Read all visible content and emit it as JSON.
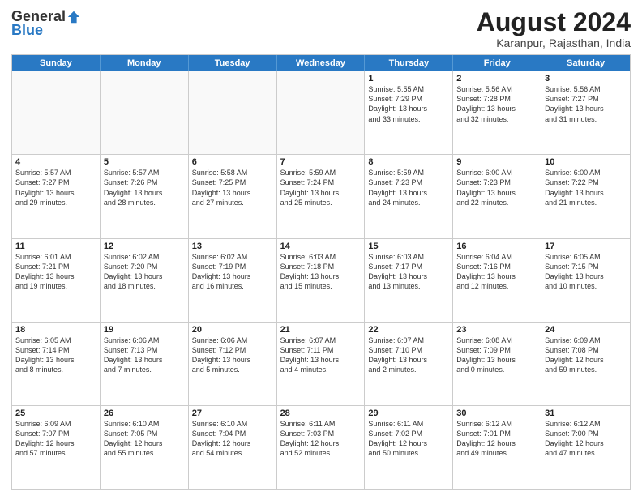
{
  "logo": {
    "general": "General",
    "blue": "Blue"
  },
  "title": "August 2024",
  "location": "Karanpur, Rajasthan, India",
  "days": [
    "Sunday",
    "Monday",
    "Tuesday",
    "Wednesday",
    "Thursday",
    "Friday",
    "Saturday"
  ],
  "weeks": [
    [
      {
        "day": "",
        "info": "",
        "empty": true
      },
      {
        "day": "",
        "info": "",
        "empty": true
      },
      {
        "day": "",
        "info": "",
        "empty": true
      },
      {
        "day": "",
        "info": "",
        "empty": true
      },
      {
        "day": "1",
        "info": "Sunrise: 5:55 AM\nSunset: 7:29 PM\nDaylight: 13 hours\nand 33 minutes.",
        "empty": false
      },
      {
        "day": "2",
        "info": "Sunrise: 5:56 AM\nSunset: 7:28 PM\nDaylight: 13 hours\nand 32 minutes.",
        "empty": false
      },
      {
        "day": "3",
        "info": "Sunrise: 5:56 AM\nSunset: 7:27 PM\nDaylight: 13 hours\nand 31 minutes.",
        "empty": false
      }
    ],
    [
      {
        "day": "4",
        "info": "Sunrise: 5:57 AM\nSunset: 7:27 PM\nDaylight: 13 hours\nand 29 minutes.",
        "empty": false
      },
      {
        "day": "5",
        "info": "Sunrise: 5:57 AM\nSunset: 7:26 PM\nDaylight: 13 hours\nand 28 minutes.",
        "empty": false
      },
      {
        "day": "6",
        "info": "Sunrise: 5:58 AM\nSunset: 7:25 PM\nDaylight: 13 hours\nand 27 minutes.",
        "empty": false
      },
      {
        "day": "7",
        "info": "Sunrise: 5:59 AM\nSunset: 7:24 PM\nDaylight: 13 hours\nand 25 minutes.",
        "empty": false
      },
      {
        "day": "8",
        "info": "Sunrise: 5:59 AM\nSunset: 7:23 PM\nDaylight: 13 hours\nand 24 minutes.",
        "empty": false
      },
      {
        "day": "9",
        "info": "Sunrise: 6:00 AM\nSunset: 7:23 PM\nDaylight: 13 hours\nand 22 minutes.",
        "empty": false
      },
      {
        "day": "10",
        "info": "Sunrise: 6:00 AM\nSunset: 7:22 PM\nDaylight: 13 hours\nand 21 minutes.",
        "empty": false
      }
    ],
    [
      {
        "day": "11",
        "info": "Sunrise: 6:01 AM\nSunset: 7:21 PM\nDaylight: 13 hours\nand 19 minutes.",
        "empty": false
      },
      {
        "day": "12",
        "info": "Sunrise: 6:02 AM\nSunset: 7:20 PM\nDaylight: 13 hours\nand 18 minutes.",
        "empty": false
      },
      {
        "day": "13",
        "info": "Sunrise: 6:02 AM\nSunset: 7:19 PM\nDaylight: 13 hours\nand 16 minutes.",
        "empty": false
      },
      {
        "day": "14",
        "info": "Sunrise: 6:03 AM\nSunset: 7:18 PM\nDaylight: 13 hours\nand 15 minutes.",
        "empty": false
      },
      {
        "day": "15",
        "info": "Sunrise: 6:03 AM\nSunset: 7:17 PM\nDaylight: 13 hours\nand 13 minutes.",
        "empty": false
      },
      {
        "day": "16",
        "info": "Sunrise: 6:04 AM\nSunset: 7:16 PM\nDaylight: 13 hours\nand 12 minutes.",
        "empty": false
      },
      {
        "day": "17",
        "info": "Sunrise: 6:05 AM\nSunset: 7:15 PM\nDaylight: 13 hours\nand 10 minutes.",
        "empty": false
      }
    ],
    [
      {
        "day": "18",
        "info": "Sunrise: 6:05 AM\nSunset: 7:14 PM\nDaylight: 13 hours\nand 8 minutes.",
        "empty": false
      },
      {
        "day": "19",
        "info": "Sunrise: 6:06 AM\nSunset: 7:13 PM\nDaylight: 13 hours\nand 7 minutes.",
        "empty": false
      },
      {
        "day": "20",
        "info": "Sunrise: 6:06 AM\nSunset: 7:12 PM\nDaylight: 13 hours\nand 5 minutes.",
        "empty": false
      },
      {
        "day": "21",
        "info": "Sunrise: 6:07 AM\nSunset: 7:11 PM\nDaylight: 13 hours\nand 4 minutes.",
        "empty": false
      },
      {
        "day": "22",
        "info": "Sunrise: 6:07 AM\nSunset: 7:10 PM\nDaylight: 13 hours\nand 2 minutes.",
        "empty": false
      },
      {
        "day": "23",
        "info": "Sunrise: 6:08 AM\nSunset: 7:09 PM\nDaylight: 13 hours\nand 0 minutes.",
        "empty": false
      },
      {
        "day": "24",
        "info": "Sunrise: 6:09 AM\nSunset: 7:08 PM\nDaylight: 12 hours\nand 59 minutes.",
        "empty": false
      }
    ],
    [
      {
        "day": "25",
        "info": "Sunrise: 6:09 AM\nSunset: 7:07 PM\nDaylight: 12 hours\nand 57 minutes.",
        "empty": false
      },
      {
        "day": "26",
        "info": "Sunrise: 6:10 AM\nSunset: 7:05 PM\nDaylight: 12 hours\nand 55 minutes.",
        "empty": false
      },
      {
        "day": "27",
        "info": "Sunrise: 6:10 AM\nSunset: 7:04 PM\nDaylight: 12 hours\nand 54 minutes.",
        "empty": false
      },
      {
        "day": "28",
        "info": "Sunrise: 6:11 AM\nSunset: 7:03 PM\nDaylight: 12 hours\nand 52 minutes.",
        "empty": false
      },
      {
        "day": "29",
        "info": "Sunrise: 6:11 AM\nSunset: 7:02 PM\nDaylight: 12 hours\nand 50 minutes.",
        "empty": false
      },
      {
        "day": "30",
        "info": "Sunrise: 6:12 AM\nSunset: 7:01 PM\nDaylight: 12 hours\nand 49 minutes.",
        "empty": false
      },
      {
        "day": "31",
        "info": "Sunrise: 6:12 AM\nSunset: 7:00 PM\nDaylight: 12 hours\nand 47 minutes.",
        "empty": false
      }
    ]
  ]
}
